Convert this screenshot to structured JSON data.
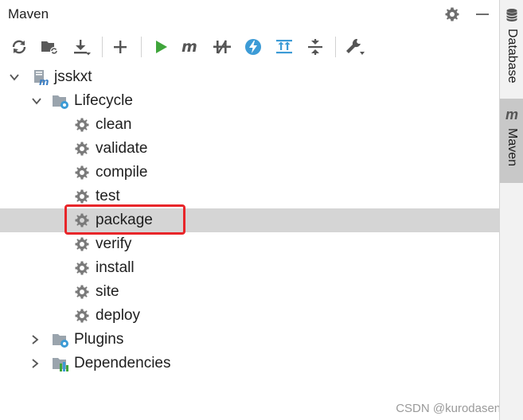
{
  "panel": {
    "title": "Maven",
    "header_icons": [
      "gear-icon",
      "minimize-icon"
    ]
  },
  "toolbar": {
    "buttons": [
      {
        "name": "reload-icon",
        "tooltip": ""
      },
      {
        "name": "generate-sources-icon",
        "tooltip": ""
      },
      {
        "name": "download-icon",
        "tooltip": ""
      },
      {
        "name": "add-icon",
        "tooltip": ""
      },
      {
        "name": "run-icon",
        "tooltip": ""
      },
      {
        "name": "maven-goal-icon",
        "tooltip": ""
      },
      {
        "name": "toggle-offline-icon",
        "tooltip": ""
      },
      {
        "name": "skip-tests-icon",
        "tooltip": ""
      },
      {
        "name": "show-dependencies-icon",
        "tooltip": ""
      },
      {
        "name": "collapse-all-icon",
        "tooltip": ""
      },
      {
        "name": "settings-wrench-icon",
        "tooltip": ""
      }
    ]
  },
  "tree": {
    "project": "jsskxt",
    "lifecycle_label": "Lifecycle",
    "goals": [
      "clean",
      "validate",
      "compile",
      "test",
      "package",
      "verify",
      "install",
      "site",
      "deploy"
    ],
    "selected_goal": "package",
    "plugins_label": "Plugins",
    "dependencies_label": "Dependencies"
  },
  "side_strip": {
    "tabs": [
      {
        "label": "Database",
        "active": false
      },
      {
        "label": "Maven",
        "active": true
      }
    ],
    "maven_glyph": "m"
  },
  "watermark": "CSDN @kurodasense",
  "colors": {
    "selection": "#d5d5d5",
    "highlight_box": "#e8262a",
    "run_green": "#3fa53b",
    "accent_blue": "#3c9bd6"
  }
}
